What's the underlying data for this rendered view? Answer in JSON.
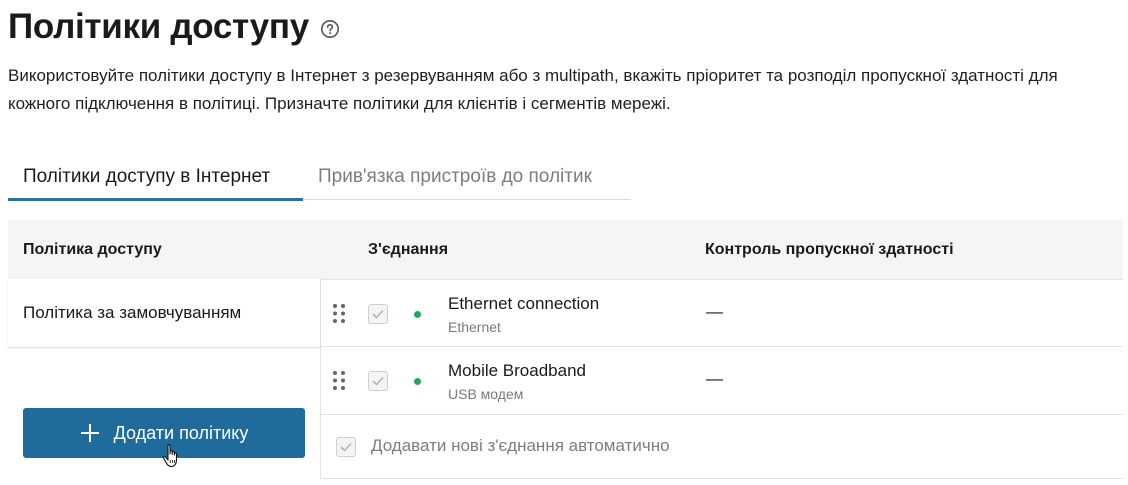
{
  "page": {
    "title": "Політики доступу",
    "description": "Використовуйте політики доступу в Інтернет з резервуванням або з multipath, вкажіть пріоритет та розподіл пропускної здатності для кожного підключення в політиці. Призначте політики для клієнтів і сегментів мережі."
  },
  "tabs": [
    {
      "label": "Політики доступу в Інтернет",
      "active": true
    },
    {
      "label": "Прив'язка пристроїв до політик",
      "active": false
    }
  ],
  "table": {
    "headers": {
      "policy": "Політика доступу",
      "connection": "З'єднання",
      "bandwidth": "Контроль пропускної здатності"
    },
    "policies": [
      {
        "name": "Політика за замовчуванням"
      }
    ],
    "connections": [
      {
        "name": "Ethernet connection",
        "type": "Ethernet",
        "bandwidth": "—",
        "checked": true,
        "status": "online"
      },
      {
        "name": "Mobile Broadband",
        "type": "USB модем",
        "bandwidth": "—",
        "checked": true,
        "status": "online"
      }
    ],
    "auto_add_label": "Додавати нові з'єднання автоматично"
  },
  "buttons": {
    "add_policy": "Додати політику"
  },
  "colors": {
    "accent": "#1e74ad",
    "button_bg": "#1e6b9c",
    "status_online": "#20a85a",
    "header_bg": "#f5f5f5"
  },
  "icons": {
    "help": "help-circle-icon",
    "drag": "drag-handle-icon",
    "plus": "plus-icon",
    "cursor": "hand-pointer-icon",
    "check": "check-icon"
  }
}
